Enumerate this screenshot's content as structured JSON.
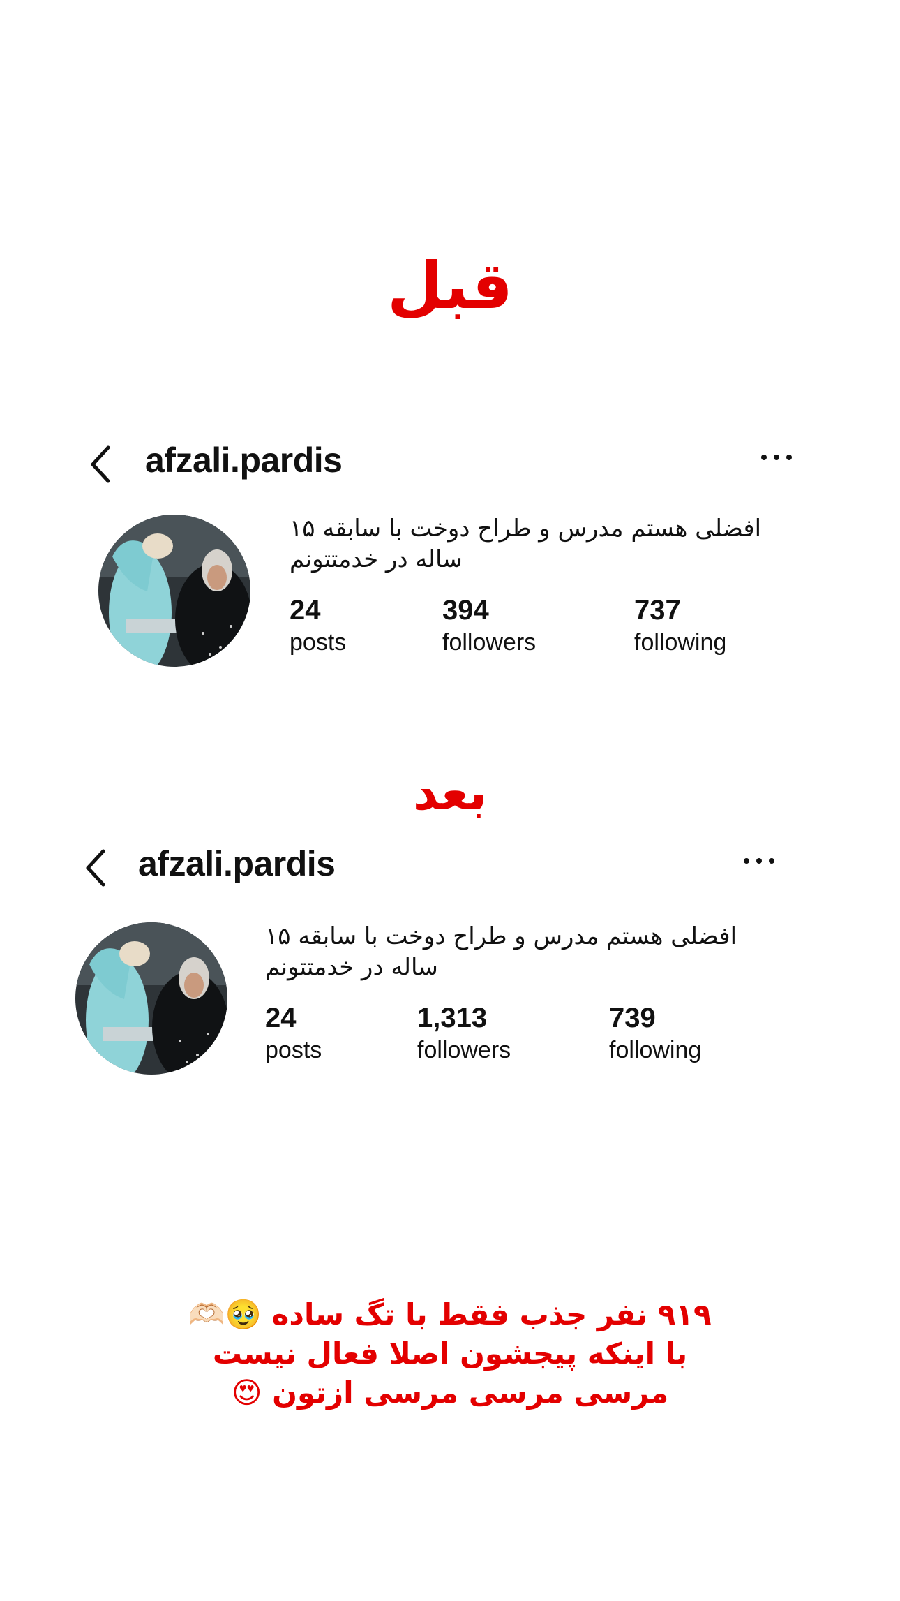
{
  "labels": {
    "before": "قبل",
    "after": "بعد"
  },
  "before": {
    "username": "afzali.pardis",
    "bio_line1": "افضلی هستم مدرس و طراح دوخت با سابقه ۱۵",
    "bio_line2": "ساله در خدمتتونم",
    "posts_count": "24",
    "posts_label": "posts",
    "followers_count": "394",
    "followers_label": "followers",
    "following_count": "737",
    "following_label": "following"
  },
  "after": {
    "username": "afzali.pardis",
    "bio_line1": "افضلی هستم مدرس و طراح دوخت با سابقه ۱۵",
    "bio_line2": "ساله در خدمتتونم",
    "posts_count": "24",
    "posts_label": "posts",
    "followers_count": "1,313",
    "followers_label": "followers",
    "following_count": "739",
    "following_label": "following"
  },
  "caption": {
    "line1": "۹۱۹ نفر جذب فقط با تگ ساده 🥹🫶🏻",
    "line2": "با اینکه پیجشون اصلا فعال نیست",
    "line3": "مرسی مرسی مرسی ازتون 😍"
  },
  "icons": {
    "back": "chevron-left-icon",
    "more": "more-horizontal-icon"
  },
  "colors": {
    "accent_red": "#e30000",
    "text": "#111111",
    "background": "#ffffff"
  }
}
